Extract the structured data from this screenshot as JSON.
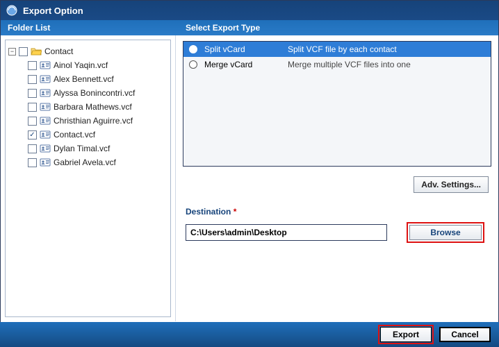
{
  "window": {
    "title": "Export Option"
  },
  "panels": {
    "left_header": "Folder List",
    "right_header": "Select Export Type"
  },
  "tree": {
    "root": {
      "label": "Contact",
      "checked": false
    },
    "items": [
      {
        "label": "Ainol Yaqin.vcf",
        "checked": false
      },
      {
        "label": "Alex Bennett.vcf",
        "checked": false
      },
      {
        "label": "Alyssa Bonincontri.vcf",
        "checked": false
      },
      {
        "label": "Barbara Mathews.vcf",
        "checked": false
      },
      {
        "label": "Christhian Aguirre.vcf",
        "checked": false
      },
      {
        "label": "Contact.vcf",
        "checked": true
      },
      {
        "label": "Dylan Timal.vcf",
        "checked": false
      },
      {
        "label": "Gabriel Avela.vcf",
        "checked": false
      }
    ]
  },
  "export_types": [
    {
      "name": "Split vCard",
      "desc": "Split VCF file by each contact",
      "selected": true
    },
    {
      "name": "Merge vCard",
      "desc": "Merge multiple VCF files into one",
      "selected": false
    }
  ],
  "buttons": {
    "adv": "Adv. Settings...",
    "browse": "Browse",
    "export": "Export",
    "cancel": "Cancel"
  },
  "destination": {
    "label": "Destination",
    "value": "C:\\Users\\admin\\Desktop"
  }
}
